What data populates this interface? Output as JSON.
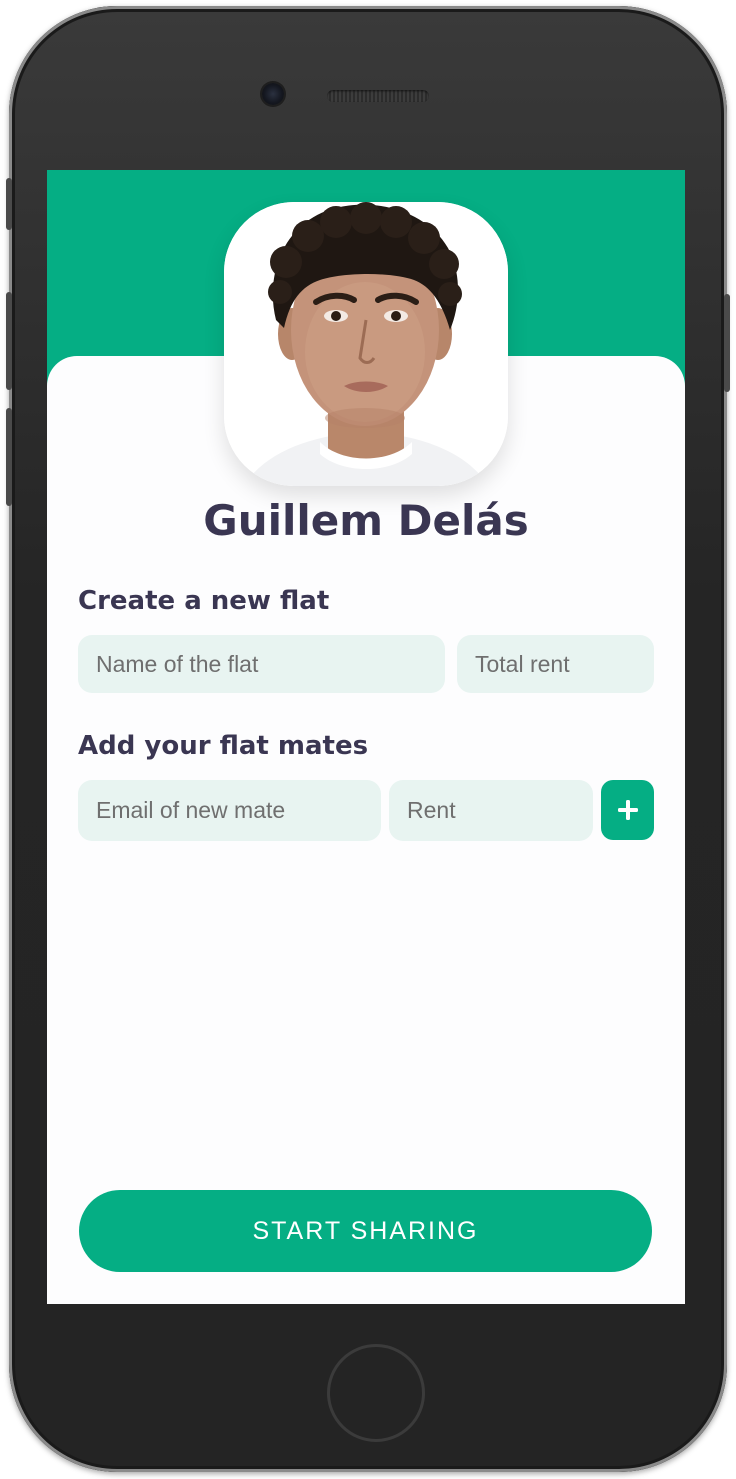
{
  "profile": {
    "name": "Guillem Delás",
    "avatar_alt": "profile-photo"
  },
  "create_flat": {
    "title": "Create a new flat",
    "flat_name_placeholder": "Name of the flat",
    "total_rent_placeholder": "Total rent"
  },
  "flat_mates": {
    "title": "Add your flat mates",
    "email_placeholder": "Email of new mate",
    "rent_placeholder": "Rent",
    "add_icon": "plus-icon"
  },
  "actions": {
    "start_label": "START SHARING"
  },
  "colors": {
    "accent": "#05ae84",
    "heading": "#3a3652",
    "field_bg": "#e8f4f1"
  }
}
